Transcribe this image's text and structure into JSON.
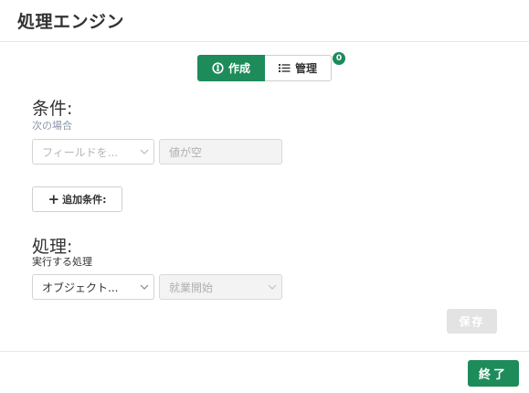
{
  "dialog": {
    "title": "処理エンジン"
  },
  "mode_toggle": {
    "create_label": "作成",
    "manage_label": "管理",
    "manage_count": "0",
    "active": "create"
  },
  "conditions": {
    "title": "条件:",
    "subtitle": "次の場合",
    "field_select_placeholder": "フィールドを...",
    "operator_value": "値が空",
    "add_condition_label": "追加条件:"
  },
  "actions": {
    "title": "処理:",
    "subtitle": "実行する処理",
    "object_select_value": "オブジェクト...",
    "action_select_value": "就業開始"
  },
  "buttons": {
    "save_label": "保存",
    "close_label": "終了"
  },
  "colors": {
    "accent": "#1e8b5a",
    "subtitle_conditions": "#8a95a8",
    "disabled_button": "#e3e3e3"
  },
  "icons": {
    "create": "compass-icon",
    "manage": "list-icon",
    "add": "plus-icon",
    "dropdown": "chevron-down-icon"
  }
}
